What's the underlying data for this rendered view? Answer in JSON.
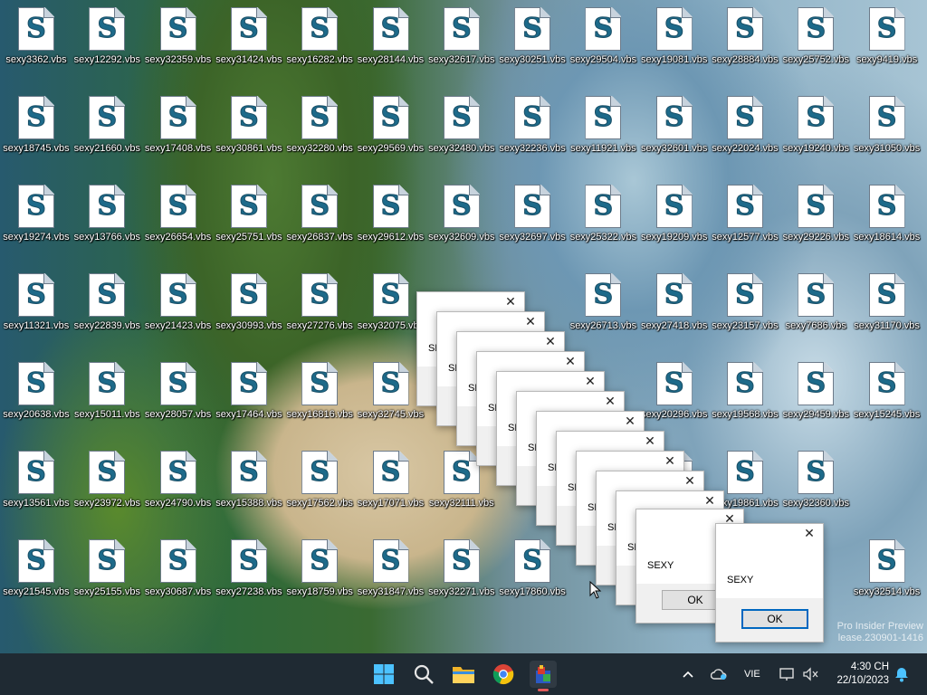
{
  "desktop_icons": [
    "sexy3362.vbs",
    "sexy12292.vbs",
    "sexy32359.vbs",
    "sexy31424.vbs",
    "sexy16282.vbs",
    "sexy28144.vbs",
    "sexy32617.vbs",
    "sexy30251.vbs",
    "sexy29504.vbs",
    "sexy19081.vbs",
    "sexy28884.vbs",
    "sexy25752.vbs",
    "sexy9419.vbs",
    "sexy18745.vbs",
    "sexy21660.vbs",
    "sexy17408.vbs",
    "sexy30861.vbs",
    "sexy32280.vbs",
    "sexy29569.vbs",
    "sexy32480.vbs",
    "sexy32236.vbs",
    "sexy11921.vbs",
    "sexy32601.vbs",
    "sexy22024.vbs",
    "sexy19240.vbs",
    "sexy31050.vbs",
    "sexy19274.vbs",
    "sexy13766.vbs",
    "sexy26654.vbs",
    "sexy25751.vbs",
    "sexy26837.vbs",
    "sexy29612.vbs",
    "sexy32609.vbs",
    "sexy32697.vbs",
    "sexy25322.vbs",
    "sexy19209.vbs",
    "sexy12577.vbs",
    "sexy29226.vbs",
    "sexy18614.vbs",
    "sexy11321.vbs",
    "sexy22839.vbs",
    "sexy21423.vbs",
    "sexy30993.vbs",
    "sexy27276.vbs",
    "sexy32075.vbs",
    "",
    "",
    "sexy26713.vbs",
    "sexy27418.vbs",
    "sexy23157.vbs",
    "sexy7686.vbs",
    "sexy31170.vbs",
    "sexy20638.vbs",
    "sexy15011.vbs",
    "sexy28057.vbs",
    "sexy17464.vbs",
    "sexy16816.vbs",
    "sexy32745.vbs",
    "",
    "",
    "",
    "sexy20296.vbs",
    "sexy19568.vbs",
    "sexy29459.vbs",
    "sexy15245.vbs",
    "sexy13561.vbs",
    "sexy23972.vbs",
    "sexy24790.vbs",
    "sexy15388.vbs",
    "sexy17562.vbs",
    "sexy17071.vbs",
    "sexy32111.vbs",
    "",
    "",
    "sexy24800.vbs",
    "sexy19861.vbs",
    "sexy32360.vbs",
    "",
    "sexy21545.vbs",
    "sexy25155.vbs",
    "sexy30687.vbs",
    "sexy27238.vbs",
    "sexy18759.vbs",
    "sexy31847.vbs",
    "sexy32271.vbs",
    "sexy17860.vbs",
    "",
    "",
    "",
    "",
    "sexy32514.vbs"
  ],
  "dialogs": {
    "message": "SEXY",
    "ok_label": "OK",
    "close_glyph": "✕"
  },
  "taskbar": {
    "language": "VIE",
    "time": "4:30 CH",
    "date": "22/10/2023"
  },
  "watermark": {
    "line1": "Pro Insider Preview",
    "line2": "lease.230901-1416"
  },
  "colors": {
    "taskbar_bg": "#1f2a33",
    "accent": "#0067c0",
    "windows_logo": "#4cc2ff"
  },
  "icons": {
    "start": "windows-logo-icon",
    "search": "search-icon",
    "explorer": "folder-icon",
    "chrome": "chrome-icon",
    "active_app": "script-app-icon",
    "chevron": "chevron-up-icon",
    "onedrive": "cloud-icon",
    "network": "network-icon",
    "volume": "volume-muted-icon",
    "notifications": "bell-icon"
  }
}
